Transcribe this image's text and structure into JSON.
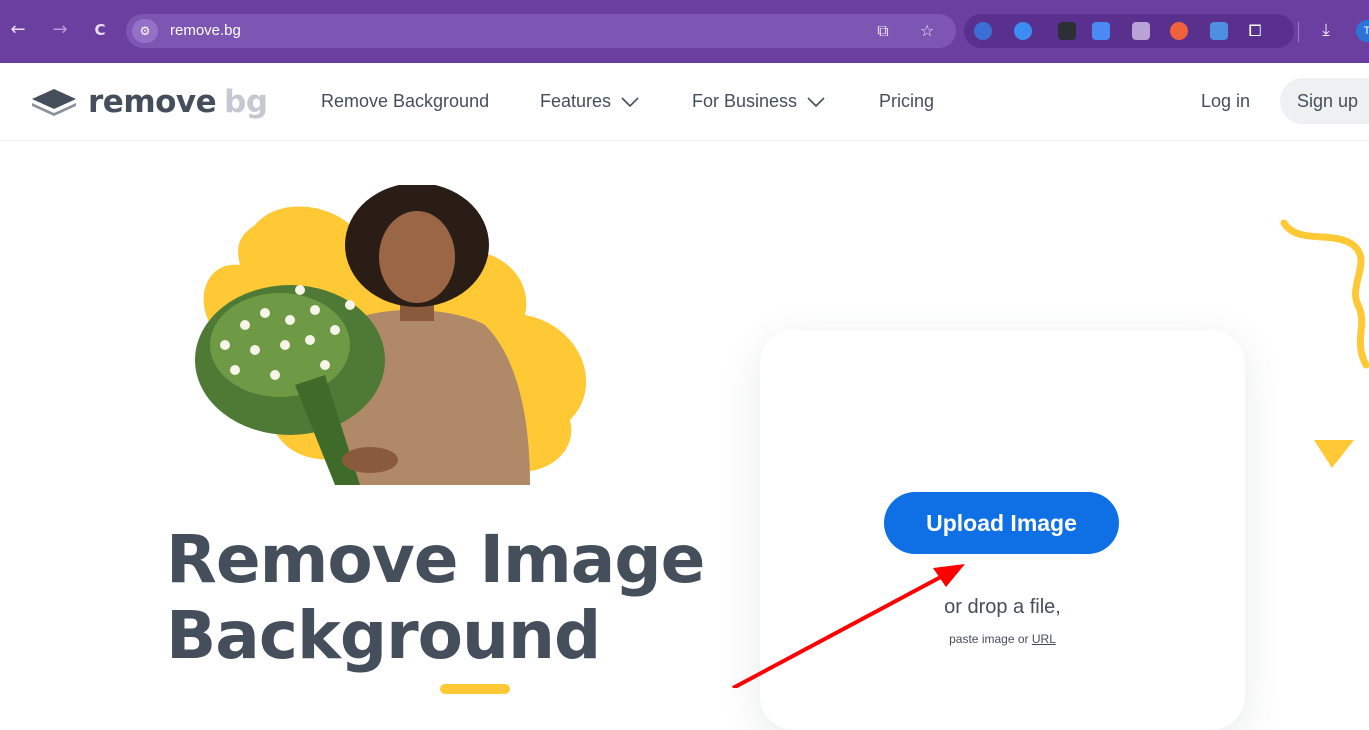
{
  "browser": {
    "url": "remove.bg",
    "back_icon": "←",
    "forward_icon": "→",
    "reload_icon": "C",
    "site_info_icon": "site-info-icon",
    "profile_initial": "T"
  },
  "header": {
    "logo_word_1": "remove",
    "logo_word_2": "bg",
    "nav": {
      "remove_background": "Remove Background",
      "features": "Features",
      "for_business": "For Business",
      "pricing": "Pricing"
    },
    "login": "Log in",
    "signup": "Sign up"
  },
  "hero": {
    "headline_line_1": "Remove Image",
    "headline_line_2": "Background"
  },
  "upload": {
    "button_label": "Upload Image",
    "drop_text": "or drop a file,",
    "paste_text": "paste image or",
    "url_link": "URL"
  },
  "colors": {
    "chrome": "#6a3fa0",
    "accent_blue": "#0f70e6",
    "brand_yellow": "#ffc936",
    "text_dark": "#454f5b",
    "annotation_red": "#ff0000"
  }
}
